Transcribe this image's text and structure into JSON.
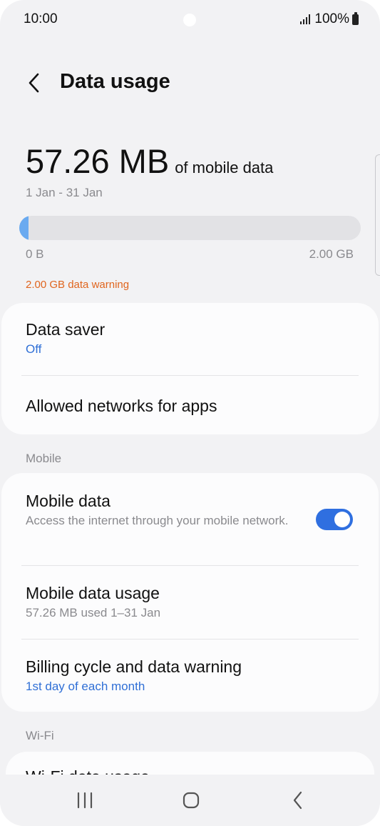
{
  "status_bar": {
    "time": "10:00",
    "battery": "100%"
  },
  "header": {
    "title": "Data usage"
  },
  "usage": {
    "amount": "57.26 MB",
    "amount_suffix": "of mobile data",
    "period": "1 Jan - 31 Jan",
    "fill_fraction": 0.028,
    "range_min": "0 B",
    "range_max": "2.00 GB",
    "warning": "2.00 GB data warning"
  },
  "card1": {
    "data_saver": {
      "title": "Data saver",
      "value": "Off"
    },
    "allowed_networks": {
      "title": "Allowed networks for apps"
    }
  },
  "section_mobile": "Mobile",
  "card2": {
    "mobile_data": {
      "title": "Mobile data",
      "subtitle": "Access the internet through your mobile network.",
      "enabled": true
    },
    "mobile_data_usage": {
      "title": "Mobile data usage",
      "subtitle": "57.26 MB used 1–31 Jan"
    },
    "billing_cycle": {
      "title": "Billing cycle and data warning",
      "value": "1st day of each month"
    }
  },
  "section_wifi": "Wi-Fi",
  "card3": {
    "wifi_data_usage": {
      "title": "Wi-Fi data usage"
    }
  },
  "colors": {
    "accent": "#2f6fe0",
    "warning": "#e0651e",
    "progress": "#6aaaf0"
  },
  "nav": {
    "icons": [
      "recent-apps-icon",
      "home-icon",
      "back-icon"
    ]
  }
}
